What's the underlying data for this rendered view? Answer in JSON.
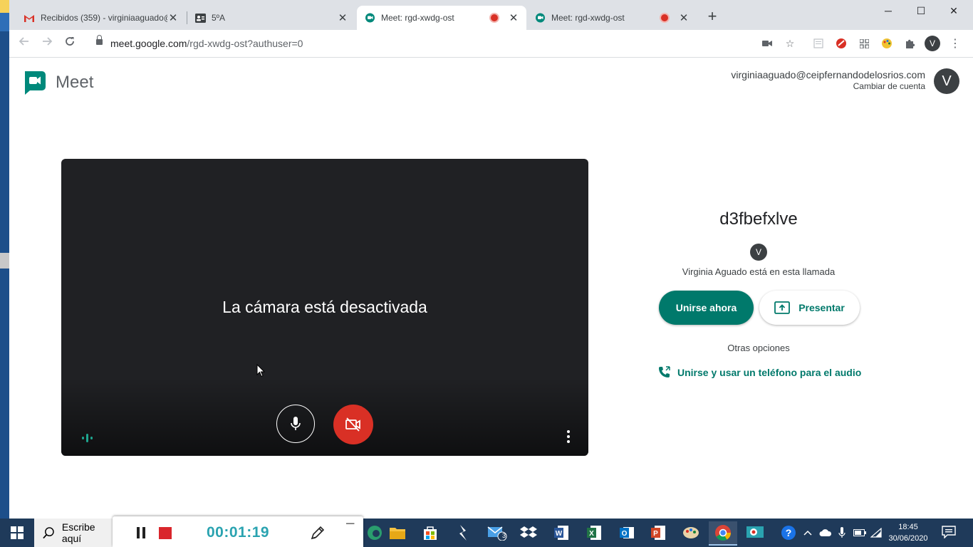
{
  "browser": {
    "tabs": [
      {
        "title": "Recibidos (359) - virginiaaguado@",
        "icon": "gmail-icon",
        "active": false,
        "recording": false
      },
      {
        "title": "5ºA",
        "icon": "classroom-icon",
        "active": false,
        "recording": false
      },
      {
        "title": "Meet: rgd-xwdg-ost",
        "icon": "meet-icon",
        "active": true,
        "recording": true
      },
      {
        "title": "Meet: rgd-xwdg-ost",
        "icon": "meet-icon",
        "active": false,
        "recording": true
      }
    ],
    "url_main": "meet.google.com",
    "url_rest": "/rgd-xwdg-ost?authuser=0",
    "profile_initial": "V"
  },
  "meet": {
    "logo_text": "Meet",
    "account_email": "virginiaaguado@ceipfernandodelosrios.com",
    "switch_account": "Cambiar de cuenta",
    "avatar_initial": "V",
    "camera_off_text": "La cámara está desactivada",
    "meeting_code": "d3fbefxlve",
    "participant_initial": "V",
    "participant_text": "Virginia Aguado está en esta llamada",
    "join_label": "Unirse ahora",
    "present_label": "Presentar",
    "other_options": "Otras opciones",
    "phone_audio_label": "Unirse y usar un teléfono para el audio",
    "accent_color": "#00796b",
    "camera_off_color": "#d93025"
  },
  "taskbar": {
    "search_placeholder": "Escribe aquí",
    "mail_badge": "3",
    "time": "18:45",
    "date": "30/06/2020"
  },
  "recorder": {
    "elapsed": "00:01:19"
  }
}
